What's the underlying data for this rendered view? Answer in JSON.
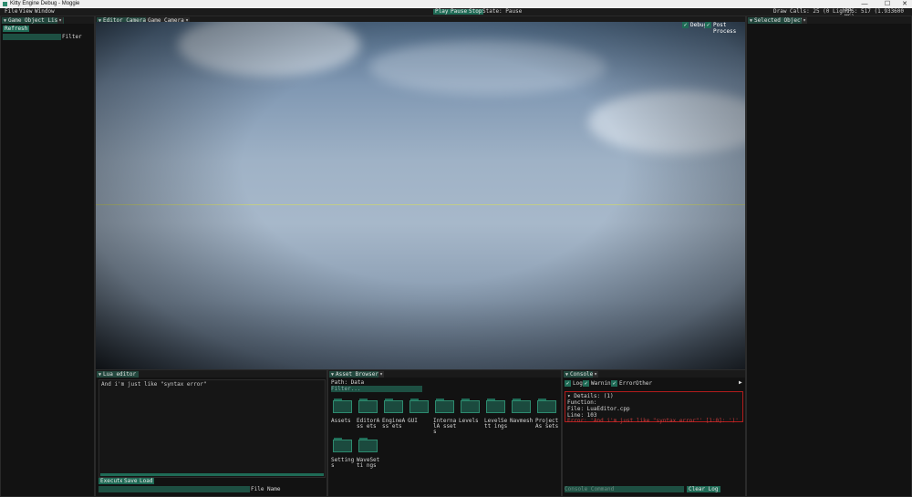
{
  "window": {
    "title": "Kitty Engine Debug - Moggie",
    "minimize": "—",
    "maximize": "☐",
    "close": "✕"
  },
  "menu": {
    "items": [
      "File",
      "View",
      "Window"
    ]
  },
  "toolbar": {
    "play": "Play",
    "pause": "Pause",
    "stop": "Stop",
    "state": "State: Pause"
  },
  "stats": {
    "draw_calls": "Draw Calls: 25 (0 Light)",
    "fps": "FPS: 517 (1.933600 MS)"
  },
  "game_object_list": {
    "tab": "Game Object List",
    "refresh": "Refresh",
    "filter_label": "Filter",
    "filter_value": ""
  },
  "viewport": {
    "tab_editor_camera": "Editor Camera",
    "tab_game_camera": "Game Camera",
    "debug": "Debug",
    "post_process": "Post Process"
  },
  "selected_object": {
    "tab": "Selected Object"
  },
  "lua_editor": {
    "tab": "Lua editor",
    "code_line": "  And i'm just like \"syntax error\"",
    "execute": "Execute",
    "save": "Save",
    "load": "Load",
    "file_name_label": "File Name",
    "file_name_value": ""
  },
  "asset_browser": {
    "tab": "Asset Browser",
    "path": "Path: Data",
    "filter_placeholder": "Filter...",
    "folders": [
      {
        "label": "Assets"
      },
      {
        "label": "EditorAss ets"
      },
      {
        "label": "EngineAss ets"
      },
      {
        "label": "GUI"
      },
      {
        "label": "InternalA ssets"
      },
      {
        "label": "Levels"
      },
      {
        "label": "LevelSett ings"
      },
      {
        "label": "Navmesh"
      },
      {
        "label": "ProjectAs sets"
      },
      {
        "label": "Settings"
      },
      {
        "label": "WaveSetti ngs"
      }
    ]
  },
  "console": {
    "tab": "Console",
    "filters": {
      "log": "Log",
      "warning": "Warning",
      "error": "Error",
      "other": "Other"
    },
    "lines": [
      "▾ Details: (1)",
      "  Function:",
      "  File: LuaEditor.cpp",
      "  Line: 103"
    ],
    "error_line": "Error: 'And i'm just like \"syntax error\"' [1:0]: ')' expected near '\"'",
    "command_placeholder": "Console Command",
    "clear_log": "Clear Log"
  },
  "colors": {
    "accent": "#1f6b56",
    "tab_active": "#23483e",
    "error": "#b21c1c",
    "background": "#121212"
  },
  "icons": {
    "check": "✓",
    "caret": "▼",
    "add": "▾",
    "play_arrow": "▶"
  }
}
